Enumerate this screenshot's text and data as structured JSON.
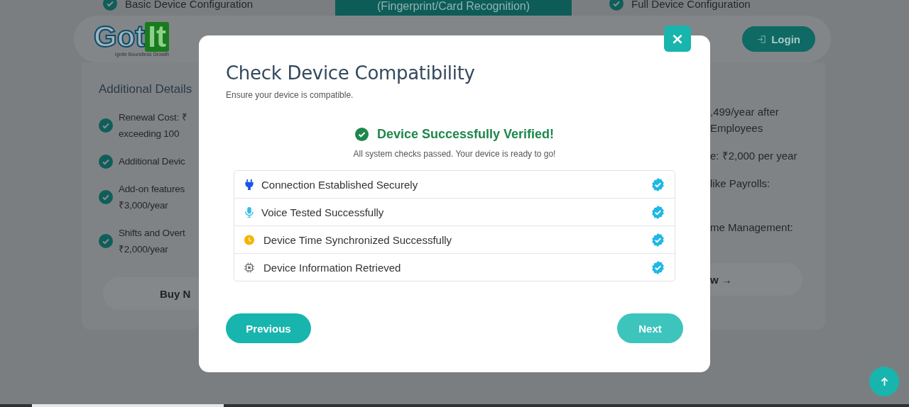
{
  "background": {
    "top_left_feature": "Basic Device Configuration",
    "top_center_feature": "(Fingerprint/Card Recognition)",
    "top_right_feature": "Full Device Configuration",
    "navbar": {
      "logo_left": "Got",
      "logo_right": "It",
      "tagline": "Ignite Boundless Growth",
      "login": "Login"
    },
    "left_card": {
      "heading": "Additional Details",
      "items": [
        {
          "lines": [
            "Renewal Cost: ₹",
            "exceeding 100"
          ]
        },
        {
          "lines": [
            "Additional Devic"
          ]
        },
        {
          "lines": [
            "Add-on features",
            "₹3,000/year"
          ]
        },
        {
          "lines": [
            "Shifts and Overt",
            "₹2,000/year"
          ]
        }
      ],
      "button": "Buy N"
    },
    "right_card": {
      "items": [
        {
          "lines": [
            ",499/year after",
            "Employees"
          ]
        },
        {
          "lines": [
            "e: ₹2,000 per year"
          ]
        },
        {
          "lines": [
            "like Payrolls:"
          ]
        },
        {
          "lines": [
            "me Management:"
          ]
        }
      ],
      "button": "w →"
    }
  },
  "modal": {
    "title": "Check Device Compatibility",
    "subtitle": "Ensure your device is compatible.",
    "close": "×",
    "status": {
      "title": "Device Successfully Verified!",
      "message": "All system checks passed. Your device is ready to go!"
    },
    "checks": [
      {
        "kind": "plug",
        "label": "Connection Established Securely",
        "passed": true
      },
      {
        "kind": "mic",
        "label": "Voice Tested Successfully",
        "passed": true
      },
      {
        "kind": "clock",
        "label": "Device Time Synchronized Successfully",
        "passed": true
      },
      {
        "kind": "chip",
        "label": "Device Information Retrieved",
        "passed": true
      }
    ],
    "buttons": {
      "previous": "Previous",
      "next": "Next"
    }
  }
}
